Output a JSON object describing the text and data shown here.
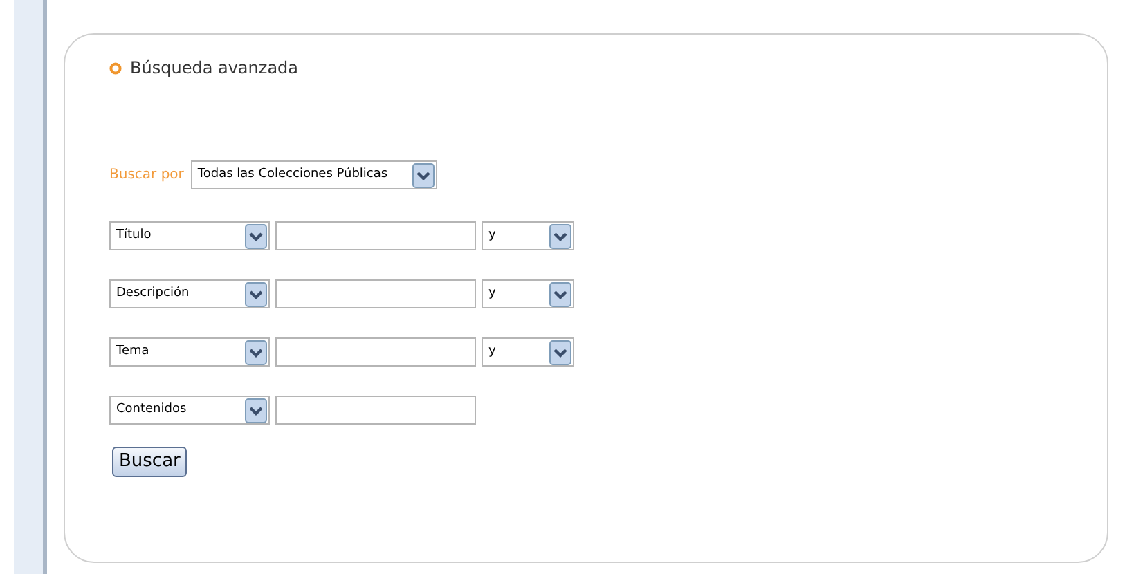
{
  "panel": {
    "title": "Búsqueda avanzada"
  },
  "scope": {
    "label": "Buscar por",
    "value": "Todas las Colecciones Públicas"
  },
  "rows": [
    {
      "field": "Título",
      "connector": "y"
    },
    {
      "field": "Descripción",
      "connector": "y"
    },
    {
      "field": "Tema",
      "connector": "y"
    },
    {
      "field": "Contenidos"
    }
  ],
  "button": "Buscar"
}
